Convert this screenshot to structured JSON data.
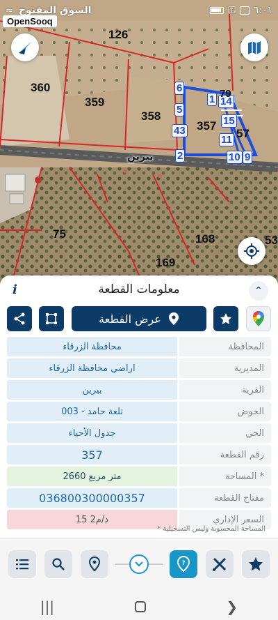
{
  "status_bar": {
    "time": "٦:٠١",
    "carrier": "السوق المفتوح"
  },
  "watermark": "OpenSooq",
  "map": {
    "parcel_numbers": [
      "126",
      "360",
      "359",
      "358",
      "357",
      "75",
      "168",
      "169",
      "53",
      "57"
    ],
    "polygon_vertices": [
      "6",
      "5",
      "43",
      "2",
      "10",
      "9",
      "11",
      "15",
      "14",
      "1",
      "79"
    ],
    "road_label": "بيرين",
    "icons": {
      "north_arrow": "compass-north-icon",
      "map_layers": "map-layers-icon",
      "locate": "crosshair-locate-icon"
    },
    "colors": {
      "parcel_outline": "#d6262c",
      "selected_polygon": "#1d4ed8"
    }
  },
  "panel": {
    "title": "معلومات القطعة",
    "info_icon_glyph": "i",
    "collapse_icon": "chevron-up-icon",
    "view_button_label": "عرض القطعة",
    "rows": [
      {
        "label": "المحافظة",
        "value": "محافظة الزرقاء"
      },
      {
        "label": "المديرية",
        "value": "اراضي محافظة الزرقاء"
      },
      {
        "label": "القرية",
        "value": "بيرين"
      },
      {
        "label": "الحوض",
        "value": "تلعة حامد - 003"
      },
      {
        "label": "الحي",
        "value": "جدول الأحياء"
      },
      {
        "label": "رقم القطعة",
        "value": "357"
      },
      {
        "label": "المساحة *",
        "value": "2660  متر مربع"
      },
      {
        "label": "مفتاح القطعة",
        "value": "036800300000357"
      },
      {
        "label": "السعر الإداري",
        "value": "15 د/م2"
      }
    ],
    "footnote": "* المساحة المحسوبة وليس التسجيلية",
    "colors": {
      "primary": "#0b3b66",
      "accent": "#1796c7",
      "value_text": "#1e6aa8",
      "row_blue": "#e2eef7",
      "row_green": "#e3f3de",
      "row_red": "#f8d7da"
    }
  },
  "toolbar": {
    "items": [
      "list-icon",
      "search-icon",
      "location-pin-icon",
      "chevron-down-icon",
      "help-pin-icon",
      "measure-tool-icon",
      "star-icon"
    ]
  }
}
